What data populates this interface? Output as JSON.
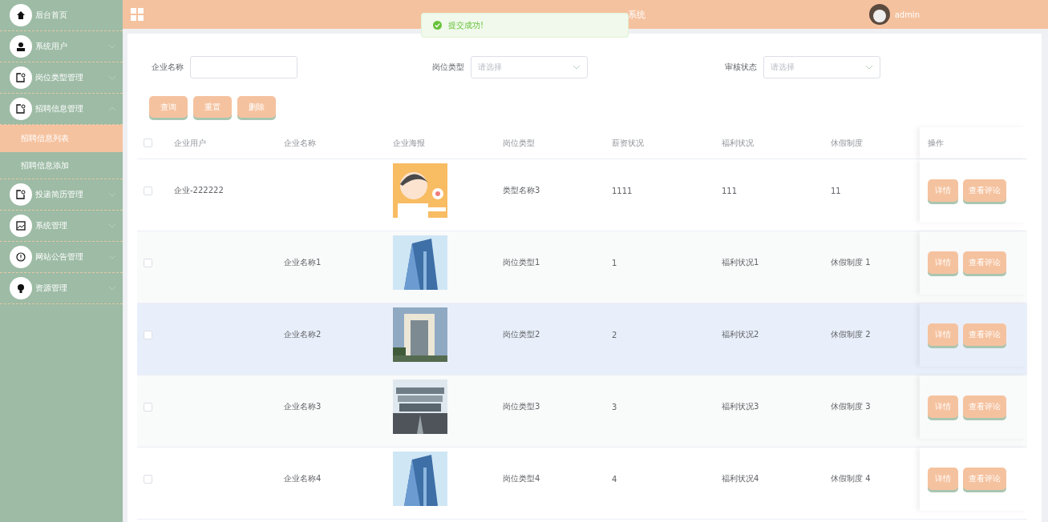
{
  "sidebar": {
    "items": [
      {
        "label": "后台首页",
        "has_children": false
      },
      {
        "label": "系统用户",
        "has_children": true,
        "expanded": false
      },
      {
        "label": "岗位类型管理",
        "has_children": true,
        "expanded": false
      },
      {
        "label": "招聘信息管理",
        "has_children": true,
        "expanded": true,
        "children": [
          {
            "label": "招聘信息列表",
            "selected": true
          },
          {
            "label": "招聘信息添加",
            "selected": false
          }
        ]
      },
      {
        "label": "投递简历管理",
        "has_children": true,
        "expanded": false
      },
      {
        "label": "系统管理",
        "has_children": true,
        "expanded": false
      },
      {
        "label": "网站公告管理",
        "has_children": true,
        "expanded": false
      },
      {
        "label": "资源管理",
        "has_children": true,
        "expanded": false
      }
    ]
  },
  "header": {
    "title": "系统",
    "user": "admin"
  },
  "toast": {
    "message": "提交成功!"
  },
  "filters": [
    {
      "label": "企业名称",
      "kind": "input"
    },
    {
      "label": "岗位类型",
      "kind": "select",
      "placeholder": "请选择"
    },
    {
      "label": "审核状态",
      "kind": "select",
      "placeholder": "请选择"
    }
  ],
  "actions": [
    "查询",
    "重置",
    "删除"
  ],
  "table": {
    "all_checked": false,
    "columns": [
      "企业用户",
      "企业名称",
      "企业海报",
      "岗位类型",
      "薪资状况",
      "福利状况",
      "休假制度",
      "操作"
    ],
    "rows": [
      {
        "checked": false,
        "user": "企业-222222",
        "name": "",
        "type": "类型名称3",
        "salary": "1111",
        "welfare": "111",
        "leave": "11",
        "highlighted": false,
        "actions": [
          "详情",
          "查看评论"
        ]
      },
      {
        "checked": false,
        "user": "",
        "name": "企业名称1",
        "type": "岗位类型1",
        "salary": "1",
        "welfare": "福利状况1",
        "leave": "休假制度 1",
        "highlighted": false,
        "actions": [
          "详情",
          "查看评论"
        ]
      },
      {
        "checked": false,
        "user": "",
        "name": "企业名称2",
        "type": "岗位类型2",
        "salary": "2",
        "welfare": "福利状况2",
        "leave": "休假制度 2",
        "highlighted": true,
        "actions": [
          "详情",
          "查看评论"
        ]
      },
      {
        "checked": false,
        "user": "",
        "name": "企业名称3",
        "type": "岗位类型3",
        "salary": "3",
        "welfare": "福利状况3",
        "leave": "休假制度 3",
        "highlighted": false,
        "actions": [
          "详情",
          "查看评论"
        ]
      },
      {
        "checked": false,
        "user": "",
        "name": "企业名称4",
        "type": "岗位类型4",
        "salary": "4",
        "welfare": "福利状况4",
        "leave": "休假制度 4",
        "highlighted": false,
        "actions": [
          "详情",
          "查看评论"
        ]
      }
    ]
  }
}
